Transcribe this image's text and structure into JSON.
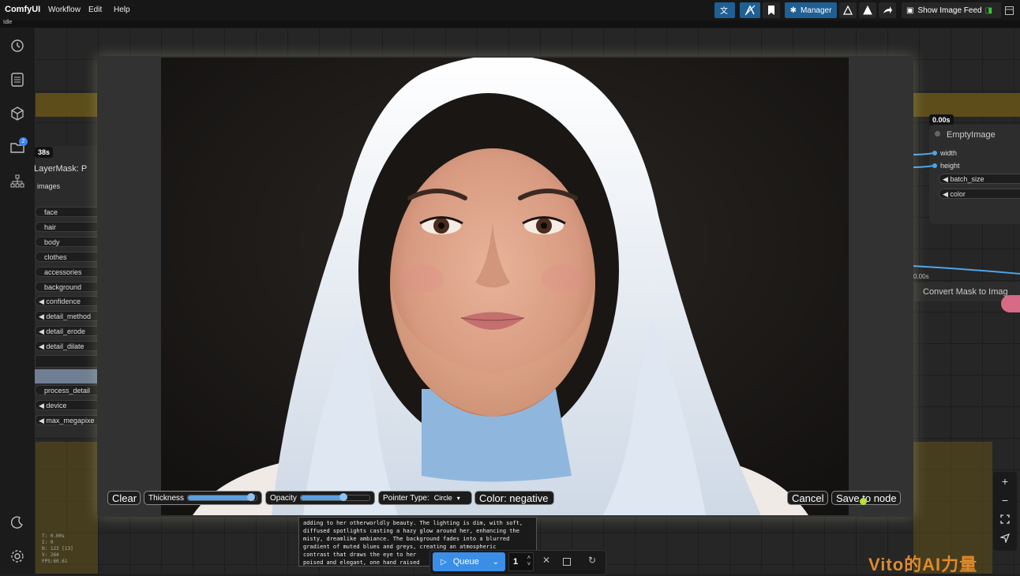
{
  "app": {
    "brand": "ComfyUI",
    "menu": [
      "Workflow",
      "Edit",
      "Help"
    ],
    "status": "Idle"
  },
  "topbar": {
    "manager_label": "Manager",
    "feed_label": "Show Image Feed"
  },
  "sidebar": {
    "items": [
      "history-icon",
      "document-icon",
      "cube-icon",
      "folder-icon",
      "node-tree-icon"
    ],
    "bottom": [
      "moon-icon",
      "gear-icon"
    ],
    "folder_badge": "2"
  },
  "left_node": {
    "timer": "38s",
    "title": "LayerMask: P",
    "input": "images",
    "widgets": [
      "face",
      "hair",
      "body",
      "clothes",
      "accessories",
      "background",
      "◀ confidence",
      "◀ detail_method",
      "◀ detail_erode",
      "◀ detail_dilate",
      "",
      "",
      "process_detail",
      "◀ device",
      "◀ max_megapixe"
    ]
  },
  "right_node": {
    "timer": "0.00s",
    "title": "EmptyImage",
    "inputs": [
      "width",
      "height"
    ],
    "widgets": [
      "◀ batch_size",
      "◀ color"
    ],
    "timer2": "0.00s",
    "convert_label": "Convert Mask to Imag"
  },
  "mask_editor": {
    "clear": "Clear",
    "thickness": "Thickness",
    "thickness_value": 0.92,
    "opacity": "Opacity",
    "opacity_value": 0.62,
    "pointer_label": "Pointer Type:",
    "pointer_value": "Circle",
    "color_label": "Color: negative",
    "cancel": "Cancel",
    "save": "Save to node"
  },
  "text_node": {
    "lines": [
      "adding to her otherworldly beauty. The lighting is dim, with soft,",
      "diffused spotlights casting a hazy glow around her, enhancing the",
      "misty, dreamlike ambiance. The background fades into a blurred",
      "gradient of muted blues and greys, creating an atmospheric",
      "contrast that draws the eye to her",
      "poised and elegant, one hand raised"
    ]
  },
  "stats": [
    "T: 0.00s",
    "I: 0",
    "N: 123 [13]",
    "V: 264",
    "FPS:60.61"
  ],
  "queue": {
    "label": "Queue",
    "count": "1"
  },
  "watermark": "Vito的AI力量"
}
